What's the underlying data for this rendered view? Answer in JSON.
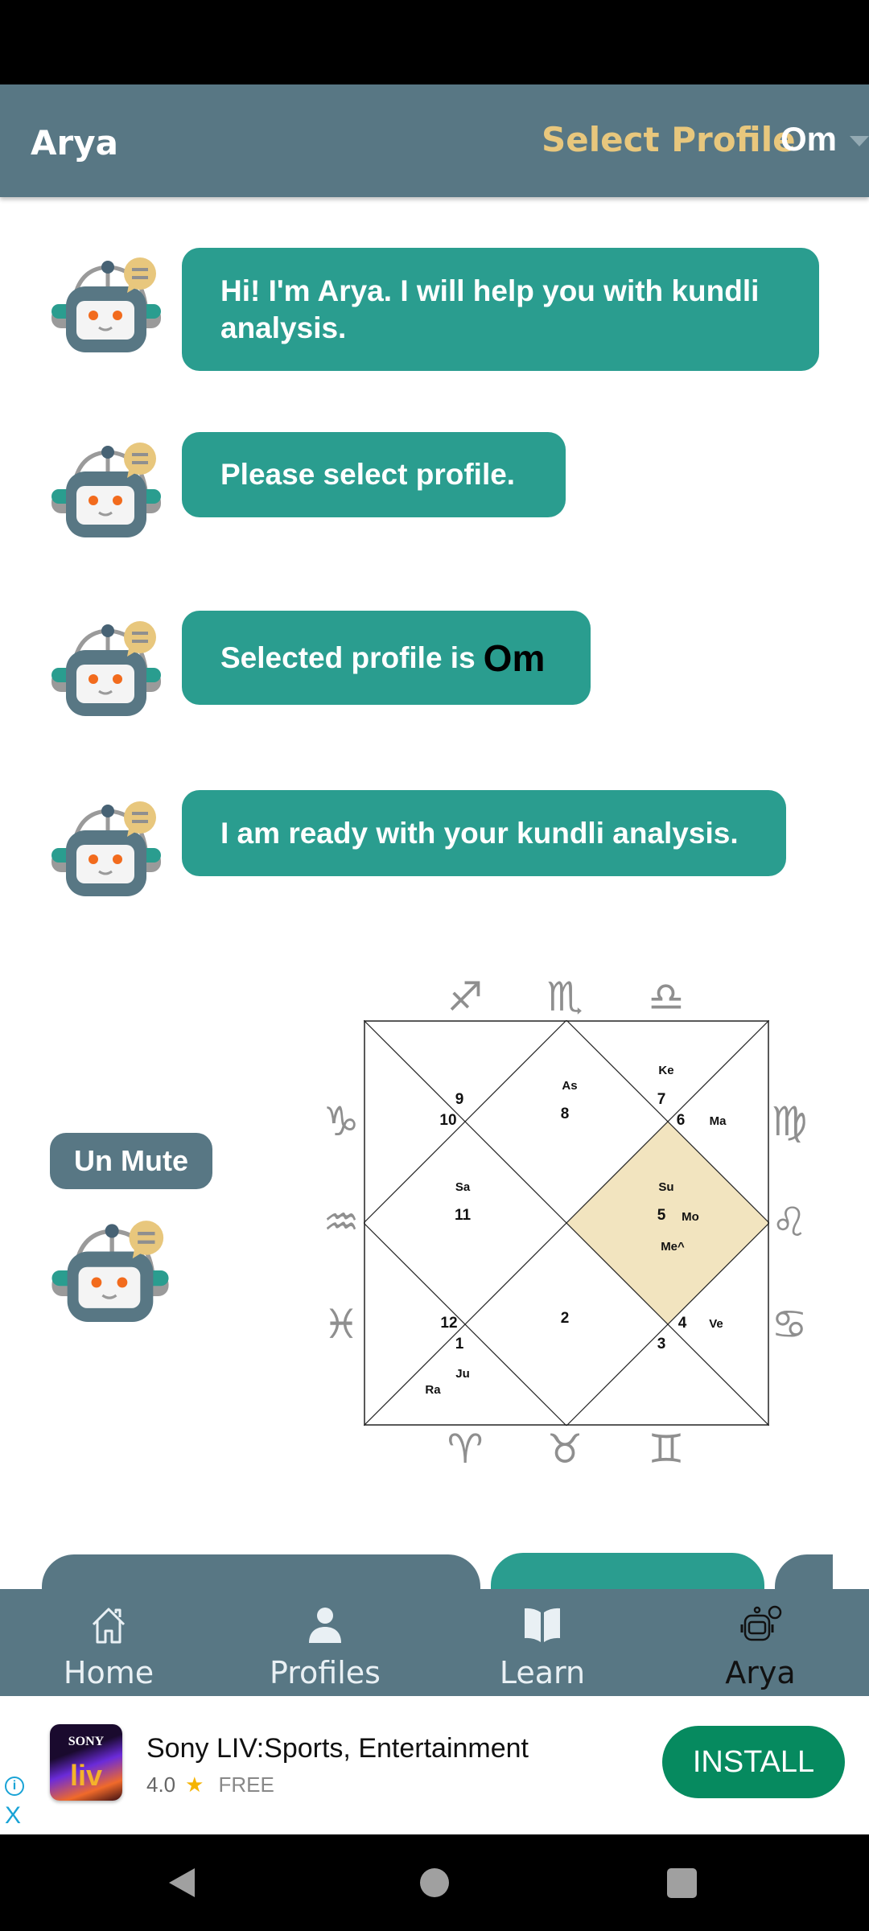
{
  "header": {
    "title": "Arya",
    "select_profile": "Select Profile",
    "profile_value": "Om"
  },
  "chat": [
    {
      "text": "Hi! I'm Arya. I will help you with kundli analysis."
    },
    {
      "text": "Please select profile."
    },
    {
      "text": "Selected profile is",
      "highlight": "Om"
    },
    {
      "text": "I am ready with your kundli analysis."
    }
  ],
  "unmute_label": "Un Mute",
  "chart_data": {
    "type": "table",
    "style": "north-indian-kundli",
    "highlight_color": "#f2e4bf",
    "highlighted_house": 10,
    "houses": [
      {
        "house": 1,
        "sign": "8",
        "planets": [
          "As"
        ]
      },
      {
        "house": 2,
        "sign": "9",
        "planets": []
      },
      {
        "house": 3,
        "sign": "10",
        "planets": []
      },
      {
        "house": 4,
        "sign": "11",
        "planets": [
          "Sa"
        ]
      },
      {
        "house": 5,
        "sign": "12",
        "planets": []
      },
      {
        "house": 6,
        "sign": "1",
        "planets": [
          "Ju",
          "Ra"
        ]
      },
      {
        "house": 7,
        "sign": "2",
        "planets": []
      },
      {
        "house": 8,
        "sign": "3",
        "planets": []
      },
      {
        "house": 9,
        "sign": "4",
        "planets": [
          "Ve"
        ]
      },
      {
        "house": 10,
        "sign": "5",
        "planets": [
          "Su",
          "Mo",
          "Me^"
        ]
      },
      {
        "house": 11,
        "sign": "6",
        "planets": [
          "Ma"
        ]
      },
      {
        "house": 12,
        "sign": "7",
        "planets": [
          "Ke"
        ]
      }
    ],
    "zodiac_icons": [
      "sagittarius",
      "scorpio",
      "libra",
      "virgo",
      "leo",
      "cancer",
      "gemini",
      "taurus",
      "aries",
      "pisces",
      "aquarius",
      "capricorn"
    ]
  },
  "nav": [
    {
      "label": "Home",
      "icon": "home-icon"
    },
    {
      "label": "Profiles",
      "icon": "person-icon"
    },
    {
      "label": "Learn",
      "icon": "book-icon"
    },
    {
      "label": "Arya",
      "icon": "robot-icon",
      "active": true
    }
  ],
  "ad": {
    "logo_text": "SONY",
    "logo_sub": "liv",
    "title": "Sony LIV:Sports, Entertainment",
    "rating": "4.0",
    "star": "★",
    "price": "FREE",
    "install": "INSTALL",
    "info": "i",
    "close": "X"
  },
  "colors": {
    "header": "#587784",
    "bubble": "#2a9d8f",
    "accent": "#e8c77d",
    "install": "#068a5f"
  }
}
